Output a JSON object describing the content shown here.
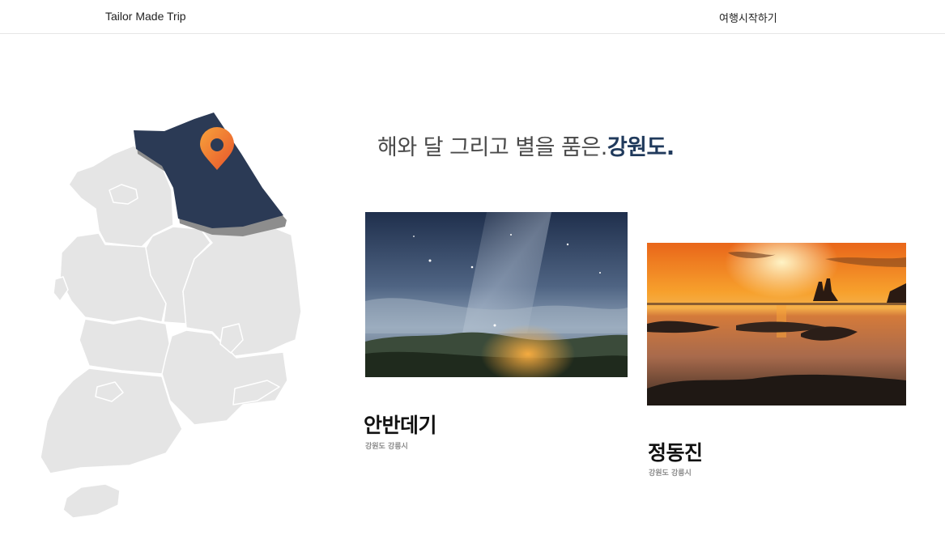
{
  "header": {
    "brand": "Tailor Made Trip",
    "start_link": "여행시작하기"
  },
  "map": {
    "highlighted_region": "강원도",
    "highlight_color": "#2b3a55",
    "base_color": "#e6e6e6",
    "marker_icon": "map-pin-icon",
    "marker_colors": [
      "#f7a23b",
      "#e8542b"
    ]
  },
  "headline": {
    "prefix": "해와 달 그리고 별을 품은.",
    "accent": "강원도."
  },
  "places": [
    {
      "name": "안반데기",
      "location": "강원도 강릉시",
      "photo": "night-sky-milky-way-photo"
    },
    {
      "name": "정동진",
      "location": "강원도 강릉시",
      "photo": "sunset-sea-ship-photo"
    }
  ]
}
